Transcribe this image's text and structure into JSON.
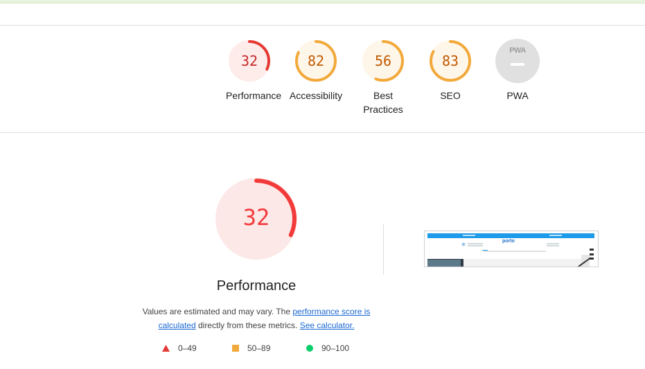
{
  "categories": [
    {
      "label": "Performance",
      "score": "32",
      "fraction": 0.32,
      "color": "#e53935",
      "bg": "#fdecea"
    },
    {
      "label": "Accessibility",
      "score": "82",
      "fraction": 0.82,
      "color": "#f2a93b",
      "bg": "#fff6ea"
    },
    {
      "label": "Best",
      "label2": "Practices",
      "score": "56",
      "fraction": 0.56,
      "color": "#f2a93b",
      "bg": "#fff6ea"
    },
    {
      "label": "SEO",
      "score": "83",
      "fraction": 0.83,
      "color": "#f2a93b",
      "bg": "#fff6ea"
    },
    {
      "label": "PWA",
      "badge": "PWA"
    }
  ],
  "main": {
    "score": "32",
    "fraction": 0.32,
    "title": "Performance",
    "desc_before": "Values are estimated and may vary. The ",
    "link1": "performance score is calculated",
    "desc_middle": " directly from these metrics. ",
    "link2": "See calculator.",
    "color": "#f33a3a",
    "bg": "#fde8e8"
  },
  "legend": {
    "fail": "0–49",
    "average": "50–89",
    "pass": "90–100",
    "fail_color": "#e53935",
    "average_color": "#f2a93b",
    "pass_color": "#0cce6b"
  },
  "thumbnail": {
    "logo": "porto"
  }
}
